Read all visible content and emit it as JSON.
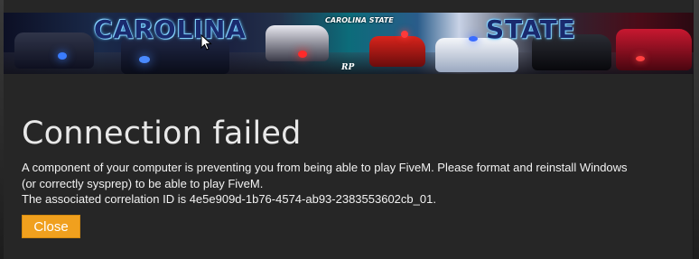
{
  "banner": {
    "word_left": "CAROLINA",
    "word_right": "STATE",
    "small_caption": "CAROLINA STATE",
    "rp_caption": "RP"
  },
  "dialog": {
    "title": "Connection failed",
    "message_line_1": "A component of your computer is preventing you from being able to play FiveM. Please format and reinstall Windows",
    "message_line_2": "(or correctly sysprep) to be able to play FiveM.",
    "message_line_3": "The associated correlation ID is 4e5e909d-1b76-4574-ab93-2383553602cb_01.",
    "close_label": "Close"
  },
  "colors": {
    "dialog_background": "#262626",
    "title_text": "#e8e8e8",
    "button_accent": "#f0a01e"
  },
  "icons": [
    "mouse-cursor-icon"
  ]
}
